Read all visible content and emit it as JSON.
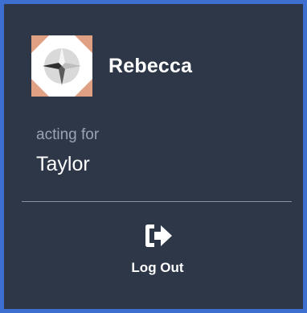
{
  "user": {
    "name": "Rebecca",
    "avatar_icon": "geometric-star-avatar-icon"
  },
  "acting": {
    "label": "acting for",
    "name": "Taylor"
  },
  "logout": {
    "icon": "sign-out-icon",
    "label": "Log Out"
  },
  "colors": {
    "panel_background": "#2d3748",
    "frame_border": "#3c6fcf",
    "primary_text": "#ffffff",
    "muted_text": "#9aa3b1",
    "avatar_accent": "#e0a083"
  }
}
